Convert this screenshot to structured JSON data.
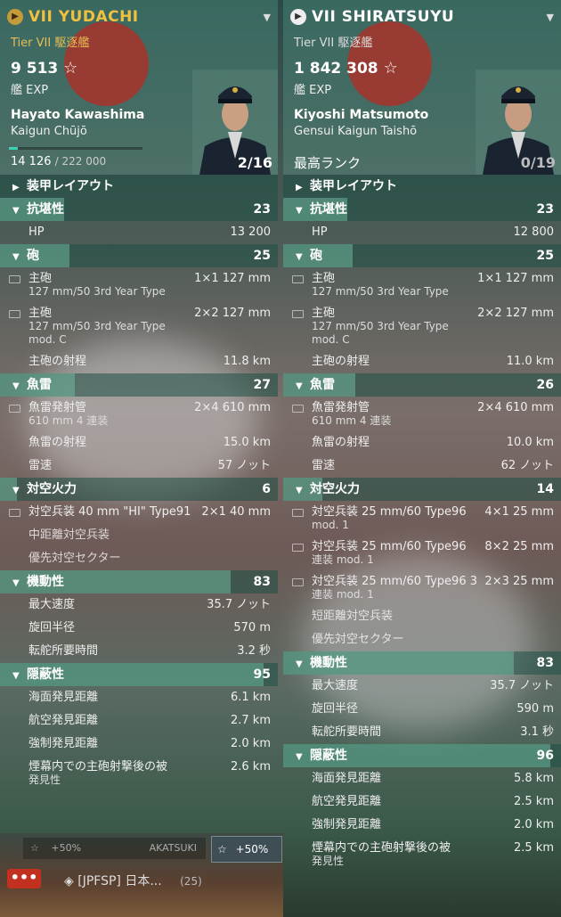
{
  "left": {
    "ship_name": "VII YUDACHI",
    "tier": "Tier VII 駆逐艦",
    "exp_value": "9 513",
    "exp_label": "艦 EXP",
    "commander_name": "Hayato Kawashima",
    "commander_rank": "Kaigun Chūjō",
    "progress_current": "14 126",
    "progress_max": "/ 222 000",
    "progress_fraction": 0.064,
    "points": "2/16",
    "sections": [
      {
        "type": "sec",
        "label": "装甲レイアウト",
        "arrow": "▶",
        "value": "",
        "bar": 0
      },
      {
        "type": "sec",
        "label": "抗堪性",
        "arrow": "▼",
        "value": "23",
        "bar": 0.23
      },
      {
        "type": "item",
        "label": "HP",
        "value": "13 200"
      },
      {
        "type": "sec",
        "label": "砲",
        "arrow": "▼",
        "value": "25",
        "bar": 0.25
      },
      {
        "type": "item",
        "icon": true,
        "label": "主砲",
        "sub": "127 mm/50 3rd Year Type",
        "value": "1×1  127 mm"
      },
      {
        "type": "item",
        "icon": true,
        "label": "主砲",
        "sub": "127 mm/50 3rd Year Type\nmod. C",
        "value": "2×2  127 mm"
      },
      {
        "type": "item",
        "label": "主砲の射程",
        "value": "11.8 km"
      },
      {
        "type": "sec",
        "label": "魚雷",
        "arrow": "▼",
        "value": "27",
        "bar": 0.27
      },
      {
        "type": "item",
        "icon": true,
        "label": "魚雷発射管",
        "sub": "610 mm 4 連装",
        "value": "2×4  610 mm"
      },
      {
        "type": "item",
        "label": "魚雷の射程",
        "value": "15.0 km"
      },
      {
        "type": "item",
        "label": "雷速",
        "value": "57 ノット"
      },
      {
        "type": "sec",
        "label": "対空火力",
        "arrow": "▼",
        "value": "6",
        "bar": 0.06
      },
      {
        "type": "item",
        "icon": true,
        "label": "対空兵装 40 mm \"HI\" Type91",
        "value": "2×1  40 mm"
      },
      {
        "type": "item",
        "dim": true,
        "label": "中距離対空兵装",
        "value": ""
      },
      {
        "type": "item",
        "dim": true,
        "label": "優先対空セクター",
        "value": ""
      },
      {
        "type": "sec",
        "label": "機動性",
        "arrow": "▼",
        "value": "83",
        "bar": 0.83
      },
      {
        "type": "item",
        "label": "最大速度",
        "value": "35.7 ノット"
      },
      {
        "type": "item",
        "label": "旋回半径",
        "value": "570 m"
      },
      {
        "type": "item",
        "label": "転舵所要時間",
        "value": "3.2 秒"
      },
      {
        "type": "sec",
        "label": "隠蔽性",
        "arrow": "▼",
        "value": "95",
        "bar": 0.95
      },
      {
        "type": "item",
        "label": "海面発見距離",
        "value": "6.1 km"
      },
      {
        "type": "item",
        "label": "航空発見距離",
        "value": "2.7 km"
      },
      {
        "type": "item",
        "label": "強制発見距離",
        "value": "2.0 km"
      },
      {
        "type": "item",
        "label": "煙幕内での主砲射撃後の被",
        "sub": "発見性",
        "value": "2.6 km"
      }
    ]
  },
  "right": {
    "ship_name": "VII SHIRATSUYU",
    "tier": "Tier VII 駆逐艦",
    "exp_value": "1 842 308",
    "exp_label": "艦 EXP",
    "commander_name": "Kiyoshi Matsumoto",
    "commander_rank": "Gensui Kaigun Taishō",
    "max_rank": "最高ランク",
    "points": "0/19",
    "sections": [
      {
        "type": "sec",
        "label": "装甲レイアウト",
        "arrow": "▶",
        "value": "",
        "bar": 0
      },
      {
        "type": "sec",
        "label": "抗堪性",
        "arrow": "▼",
        "value": "23",
        "bar": 0.23
      },
      {
        "type": "item",
        "label": "HP",
        "value": "12 800"
      },
      {
        "type": "sec",
        "label": "砲",
        "arrow": "▼",
        "value": "25",
        "bar": 0.25
      },
      {
        "type": "item",
        "icon": true,
        "label": "主砲",
        "sub": "127 mm/50 3rd Year Type",
        "value": "1×1  127 mm"
      },
      {
        "type": "item",
        "icon": true,
        "label": "主砲",
        "sub": "127 mm/50 3rd Year Type\nmod. C",
        "value": "2×2  127 mm"
      },
      {
        "type": "item",
        "label": "主砲の射程",
        "value": "11.0 km"
      },
      {
        "type": "sec",
        "label": "魚雷",
        "arrow": "▼",
        "value": "26",
        "bar": 0.26
      },
      {
        "type": "item",
        "icon": true,
        "label": "魚雷発射管",
        "sub": "610 mm 4 連装",
        "value": "2×4  610 mm"
      },
      {
        "type": "item",
        "label": "魚雷の射程",
        "value": "10.0 km"
      },
      {
        "type": "item",
        "label": "雷速",
        "value": "62 ノット"
      },
      {
        "type": "sec",
        "label": "対空火力",
        "arrow": "▼",
        "value": "14",
        "bar": 0.14
      },
      {
        "type": "item",
        "icon": true,
        "label": "対空兵装 25 mm/60 Type96",
        "sub": "mod. 1",
        "value": "4×1  25 mm"
      },
      {
        "type": "item",
        "icon": true,
        "label": "対空兵装 25 mm/60 Type96",
        "sub": "連装 mod. 1",
        "value": "8×2  25 mm"
      },
      {
        "type": "item",
        "icon": true,
        "label": "対空兵装 25 mm/60 Type96 3",
        "sub": "連装 mod. 1",
        "value": "2×3  25 mm"
      },
      {
        "type": "item",
        "dim": true,
        "label": "短距離対空兵装",
        "value": ""
      },
      {
        "type": "item",
        "dim": true,
        "label": "優先対空セクター",
        "value": ""
      },
      {
        "type": "sec",
        "label": "機動性",
        "arrow": "▼",
        "value": "83",
        "bar": 0.83
      },
      {
        "type": "item",
        "label": "最大速度",
        "value": "35.7 ノット"
      },
      {
        "type": "item",
        "label": "旋回半径",
        "value": "590 m"
      },
      {
        "type": "item",
        "label": "転舵所要時間",
        "value": "3.1 秒"
      },
      {
        "type": "sec",
        "label": "隠蔽性",
        "arrow": "▼",
        "value": "96",
        "bar": 0.96
      },
      {
        "type": "item",
        "label": "海面発見距離",
        "value": "5.8 km"
      },
      {
        "type": "item",
        "label": "航空発見距離",
        "value": "2.5 km"
      },
      {
        "type": "item",
        "label": "強制発見距離",
        "value": "2.0 km"
      },
      {
        "type": "item",
        "label": "煙幕内での主砲射撃後の被",
        "sub": "発見性",
        "value": "2.5 km"
      }
    ]
  },
  "bottom": {
    "bonus1": "+50%",
    "bonus1_name": "AKATSUKI",
    "bonus2": "+50%",
    "chat_button": "•••",
    "chat_text": "[JPFSP] 日本...",
    "chat_count": "(25)"
  }
}
